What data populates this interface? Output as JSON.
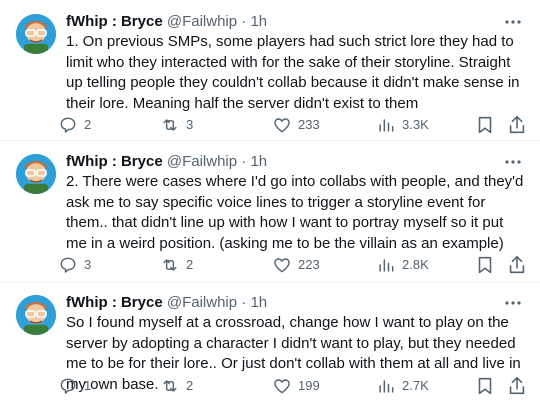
{
  "tweets": [
    {
      "display_name": "fWhip : Bryce",
      "handle": "@Failwhip",
      "separator": "·",
      "time": "1h",
      "text": "1. On previous SMPs, some players had such strict lore they had to limit who they interacted with for the sake of their storyline. Straight up telling people they couldn't collab because it didn't make sense in their lore. Meaning half the server didn't exist to them",
      "replies": "2",
      "reposts": "3",
      "likes": "233",
      "views": "3.3K"
    },
    {
      "display_name": "fWhip : Bryce",
      "handle": "@Failwhip",
      "separator": "·",
      "time": "1h",
      "text": "2. There were cases where I'd go into collabs with people, and they'd ask me to say specific voice lines to trigger a storyline event for them.. that didn't line up with how I want to portray myself so it put me in a weird position. (asking me to be the villain as an example)",
      "replies": "3",
      "reposts": "2",
      "likes": "223",
      "views": "2.8K"
    },
    {
      "display_name": "fWhip : Bryce",
      "handle": "@Failwhip",
      "separator": "·",
      "time": "1h",
      "text": "So I found myself at a crossroad, change how I want to play on the server by adopting a character I didn't want to play, but they needed me to be for their lore.. Or just don't collab with them at all and live in my own base.",
      "replies": "1",
      "reposts": "2",
      "likes": "199",
      "views": "2.7K"
    }
  ],
  "icons": {
    "more": "more-dots-icon",
    "reply": "reply-bubble-icon",
    "repost": "repost-arrows-icon",
    "like": "heart-icon",
    "views": "views-bars-icon",
    "bookmark": "bookmark-icon",
    "share": "share-upload-icon"
  },
  "colors": {
    "text": "#0f1419",
    "secondary": "#536471",
    "avatar_bg": "#2f9fd8"
  }
}
